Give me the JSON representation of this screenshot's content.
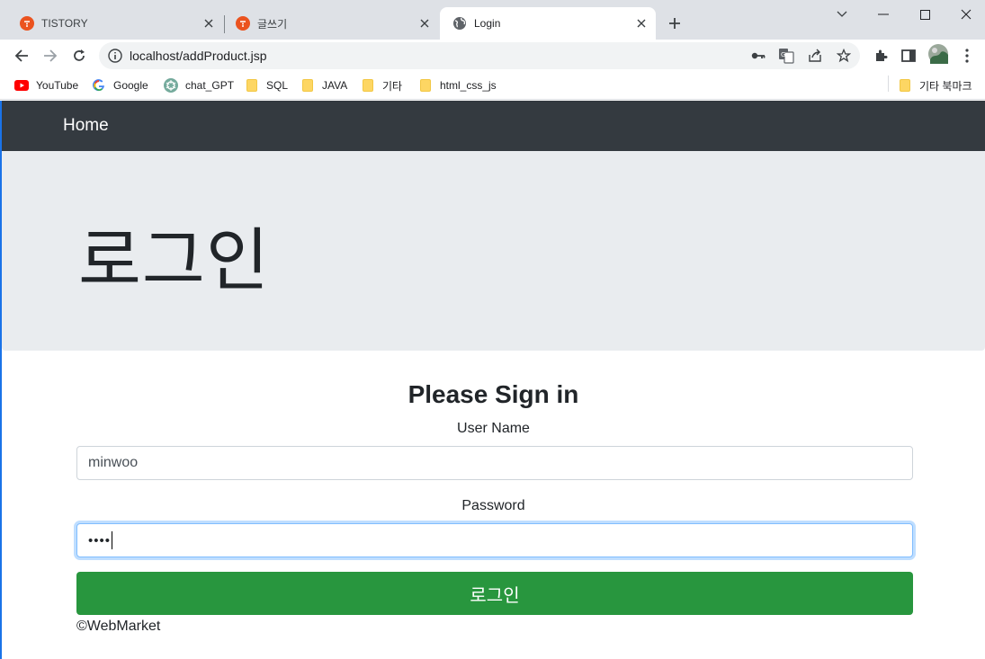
{
  "tabs": [
    {
      "title": "TISTORY"
    },
    {
      "title": "글쓰기"
    },
    {
      "title": "Login"
    }
  ],
  "address_bar": {
    "url": "localhost/addProduct.jsp"
  },
  "bookmarks": [
    {
      "label": "YouTube"
    },
    {
      "label": "Google"
    },
    {
      "label": "chat_GPT"
    },
    {
      "label": "SQL"
    },
    {
      "label": "JAVA"
    },
    {
      "label": "기타"
    },
    {
      "label": "html_css_js"
    }
  ],
  "other_bookmarks": "기타 북마크",
  "navbar": {
    "brand": "Home"
  },
  "jumbotron": {
    "title": "로그인"
  },
  "form": {
    "heading": "Please Sign in",
    "username_label": "User Name",
    "username_value": "minwoo",
    "password_label": "Password",
    "password_masked": "••••",
    "submit_label": "로그인"
  },
  "footer": {
    "text": "©WebMarket"
  },
  "colors": {
    "navbar": "#343a40",
    "jumbotron": "#e9ecef",
    "button": "#28963e",
    "tistory": "#eb531f"
  }
}
